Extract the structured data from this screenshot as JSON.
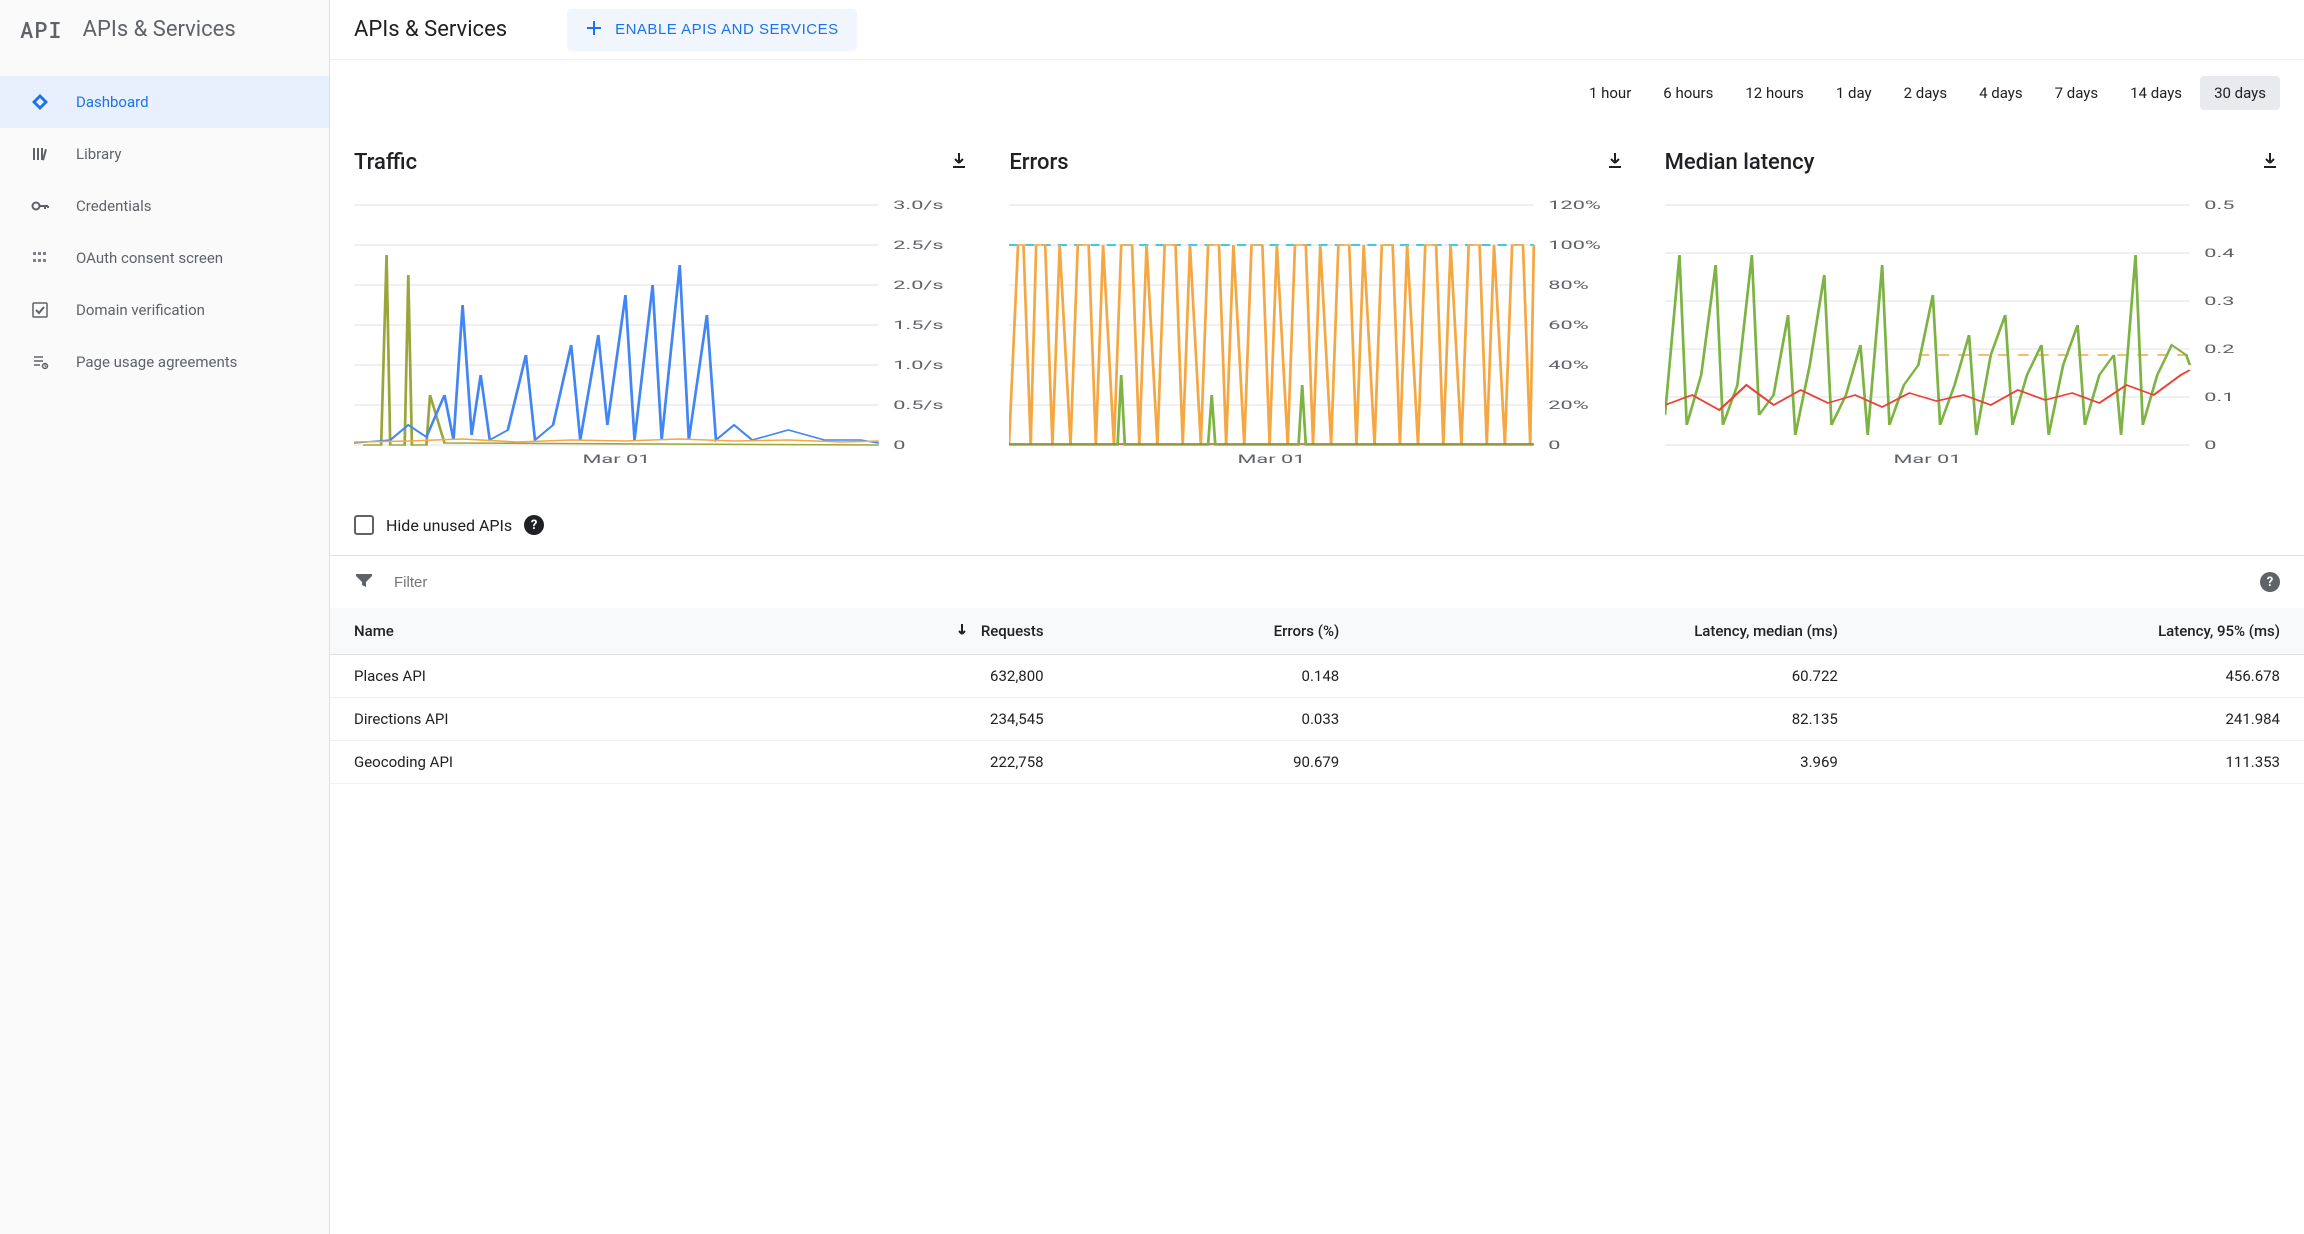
{
  "sidebar": {
    "logo": "API",
    "title": "APIs & Services",
    "items": [
      {
        "label": "Dashboard",
        "icon": "diamond",
        "active": true
      },
      {
        "label": "Library",
        "icon": "library",
        "active": false
      },
      {
        "label": "Credentials",
        "icon": "key",
        "active": false
      },
      {
        "label": "OAuth consent screen",
        "icon": "consent",
        "active": false
      },
      {
        "label": "Domain verification",
        "icon": "check",
        "active": false
      },
      {
        "label": "Page usage agreements",
        "icon": "agreement",
        "active": false
      }
    ]
  },
  "header": {
    "title": "APIs & Services",
    "enable_button": "ENABLE APIS AND SERVICES"
  },
  "time_range": {
    "options": [
      "1 hour",
      "6 hours",
      "12 hours",
      "1 day",
      "2 days",
      "4 days",
      "7 days",
      "14 days",
      "30 days"
    ],
    "selected": "30 days"
  },
  "charts": [
    {
      "title": "Traffic",
      "y_ticks": [
        "3.0/s",
        "2.5/s",
        "2.0/s",
        "1.5/s",
        "1.0/s",
        "0.5/s",
        "0"
      ],
      "x_label": "Mar 01"
    },
    {
      "title": "Errors",
      "y_ticks": [
        "120%",
        "100%",
        "80%",
        "60%",
        "40%",
        "20%",
        "0"
      ],
      "x_label": "Mar 01"
    },
    {
      "title": "Median latency",
      "y_ticks": [
        "0.5",
        "0.4",
        "0.3",
        "0.2",
        "0.1",
        "0"
      ],
      "x_label": "Mar 01"
    }
  ],
  "chart_data": [
    {
      "type": "line",
      "title": "Traffic",
      "xlabel": "",
      "ylabel": "",
      "ylim": [
        0,
        3.0
      ],
      "y_unit": "/s",
      "x_tick": "Mar 01",
      "series": [
        {
          "name": "blue",
          "color": "#4285f4",
          "values_approx": "spiky, mostly 0.1–0.5/s with peaks up to ~2.3/s near middle"
        },
        {
          "name": "olive",
          "color": "#9aa63c",
          "values_approx": "few tall spikes early up to ~2.5/s, otherwise near 0"
        },
        {
          "name": "orange",
          "color": "#f4a742",
          "values_approx": "low baseline ~0.05–0.15/s throughout"
        }
      ]
    },
    {
      "type": "line",
      "title": "Errors",
      "xlabel": "",
      "ylabel": "",
      "ylim": [
        0,
        120
      ],
      "y_unit": "%",
      "x_tick": "Mar 01",
      "series": [
        {
          "name": "orange",
          "color": "#f4a742",
          "values_approx": "oscillates frequently between 0% and 100%"
        },
        {
          "name": "cyan-dashed",
          "color": "#00bcd4",
          "values_approx": "flat near 100%"
        },
        {
          "name": "red",
          "color": "#ea4335",
          "values_approx": "near 0% baseline"
        },
        {
          "name": "green",
          "color": "#7cb342",
          "values_approx": "occasional spikes mid-range"
        }
      ]
    },
    {
      "type": "line",
      "title": "Median latency",
      "xlabel": "",
      "ylabel": "",
      "ylim": [
        0,
        0.5
      ],
      "y_unit": "",
      "x_tick": "Mar 01",
      "series": [
        {
          "name": "green",
          "color": "#7cb342",
          "values_approx": "noisy 0.05–0.25 with spikes to ~0.4"
        },
        {
          "name": "red",
          "color": "#ea4335",
          "values_approx": "noisy around 0.08–0.15"
        },
        {
          "name": "orange-dashed",
          "color": "#f4a742",
          "values_approx": "flat ~0.18 in later half"
        }
      ]
    }
  ],
  "hide_unused": {
    "label": "Hide unused APIs",
    "checked": false
  },
  "filter": {
    "placeholder": "Filter"
  },
  "table": {
    "columns": [
      "Name",
      "Requests",
      "Errors (%)",
      "Latency, median (ms)",
      "Latency, 95% (ms)"
    ],
    "sort_column": "Requests",
    "sort_dir": "desc",
    "rows": [
      {
        "name": "Places API",
        "requests": "632,800",
        "errors": "0.148",
        "latency_median": "60.722",
        "latency_95": "456.678"
      },
      {
        "name": "Directions API",
        "requests": "234,545",
        "errors": "0.033",
        "latency_median": "82.135",
        "latency_95": "241.984"
      },
      {
        "name": "Geocoding API",
        "requests": "222,758",
        "errors": "90.679",
        "latency_median": "3.969",
        "latency_95": "111.353"
      }
    ]
  }
}
